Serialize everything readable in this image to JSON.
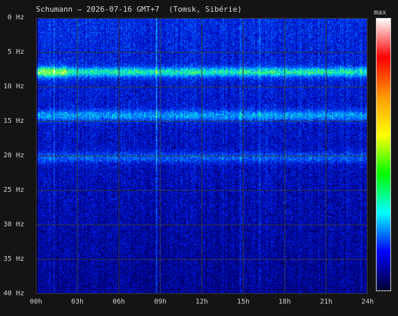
{
  "chart_data": {
    "type": "heatmap",
    "title": "Schumann – 2026-07-16 GMT+7  (Tomsk, Sibérie)",
    "x_ticks": [
      "00h",
      "03h",
      "06h",
      "09h",
      "12h",
      "15h",
      "18h",
      "21h",
      "24h"
    ],
    "x_tick_values": [
      0,
      3,
      6,
      9,
      12,
      15,
      18,
      21,
      24
    ],
    "xlim": [
      0,
      24
    ],
    "y_ticks": [
      "0 Hz",
      "5 Hz",
      "10 Hz",
      "15 Hz",
      "20 Hz",
      "25 Hz",
      "30 Hz",
      "35 Hz",
      "40 Hz"
    ],
    "y_tick_values": [
      0,
      5,
      10,
      15,
      20,
      25,
      30,
      35,
      40
    ],
    "ylim": [
      0,
      40
    ],
    "y_inverted": true,
    "grid": true,
    "colorbar_label": "max",
    "colormap": [
      "#ffffff",
      "#ff0000",
      "#ff9900",
      "#ffff00",
      "#00ff00",
      "#00ffff",
      "#0000ff",
      "#000030"
    ],
    "resonance_bands_hz": [
      7.8,
      14.1,
      20.2
    ],
    "bright_vertical_streaks_hour": [
      1.3,
      8.7,
      14.8,
      16.2
    ]
  }
}
